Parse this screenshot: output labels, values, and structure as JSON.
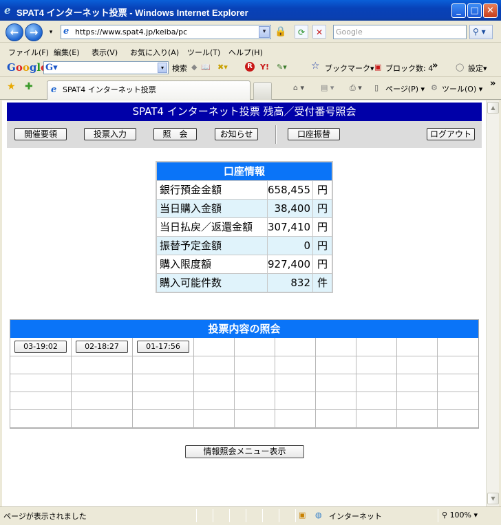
{
  "window": {
    "title": "SPAT4 インターネット投票 - Windows Internet Explorer",
    "minimize": "_",
    "maximize": "□",
    "close": "✕"
  },
  "address": {
    "url": "https://www.spat4.jp/keiba/pc",
    "search_placeholder": "Google"
  },
  "menu": [
    "ファイル(F)",
    "編集(E)",
    "表示(V)",
    "お気に入り(A)",
    "ツール(T)",
    "ヘルプ(H)"
  ],
  "google_toolbar": {
    "logo": [
      "G",
      "o",
      "o",
      "g",
      "l",
      "e"
    ],
    "search_label": "検索",
    "bookmarks": "ブックマーク▾",
    "blocked": "ブロック数: 4",
    "more": "»",
    "settings": "設定▾"
  },
  "tabs": {
    "active_label": "SPAT4 インターネット投票",
    "page_menu": "ページ(P) ▾",
    "tools_menu": "ツール(O) ▾",
    "more": "»"
  },
  "page": {
    "header": "SPAT4 インターネット投票 残高／受付番号照会",
    "nav": {
      "guide": "開催要領",
      "vote_input": "投票入力",
      "inquiry": "照　会",
      "notice": "お知らせ",
      "transfer": "口座振替",
      "logout": "ログアウト"
    },
    "account": {
      "title": "口座情報",
      "rows": [
        {
          "label": "銀行預金金額",
          "value": "658,455",
          "unit": "円"
        },
        {
          "label": "当日購入金額",
          "value": "38,400",
          "unit": "円"
        },
        {
          "label": "当日払戻／返還金額",
          "value": "307,410",
          "unit": "円"
        },
        {
          "label": "振替予定金額",
          "value": "0",
          "unit": "円"
        },
        {
          "label": "購入限度額",
          "value": "927,400",
          "unit": "円"
        },
        {
          "label": "購入可能件数",
          "value": "832",
          "unit": "件"
        }
      ]
    },
    "history": {
      "title": "投票内容の照会",
      "buttons": [
        "03-19:02",
        "02-18:27",
        "01-17:56"
      ]
    },
    "info_menu_button": "情報照会メニュー表示"
  },
  "status": {
    "text": "ページが表示されました",
    "zone": "インターネット",
    "zoom": "100%"
  }
}
